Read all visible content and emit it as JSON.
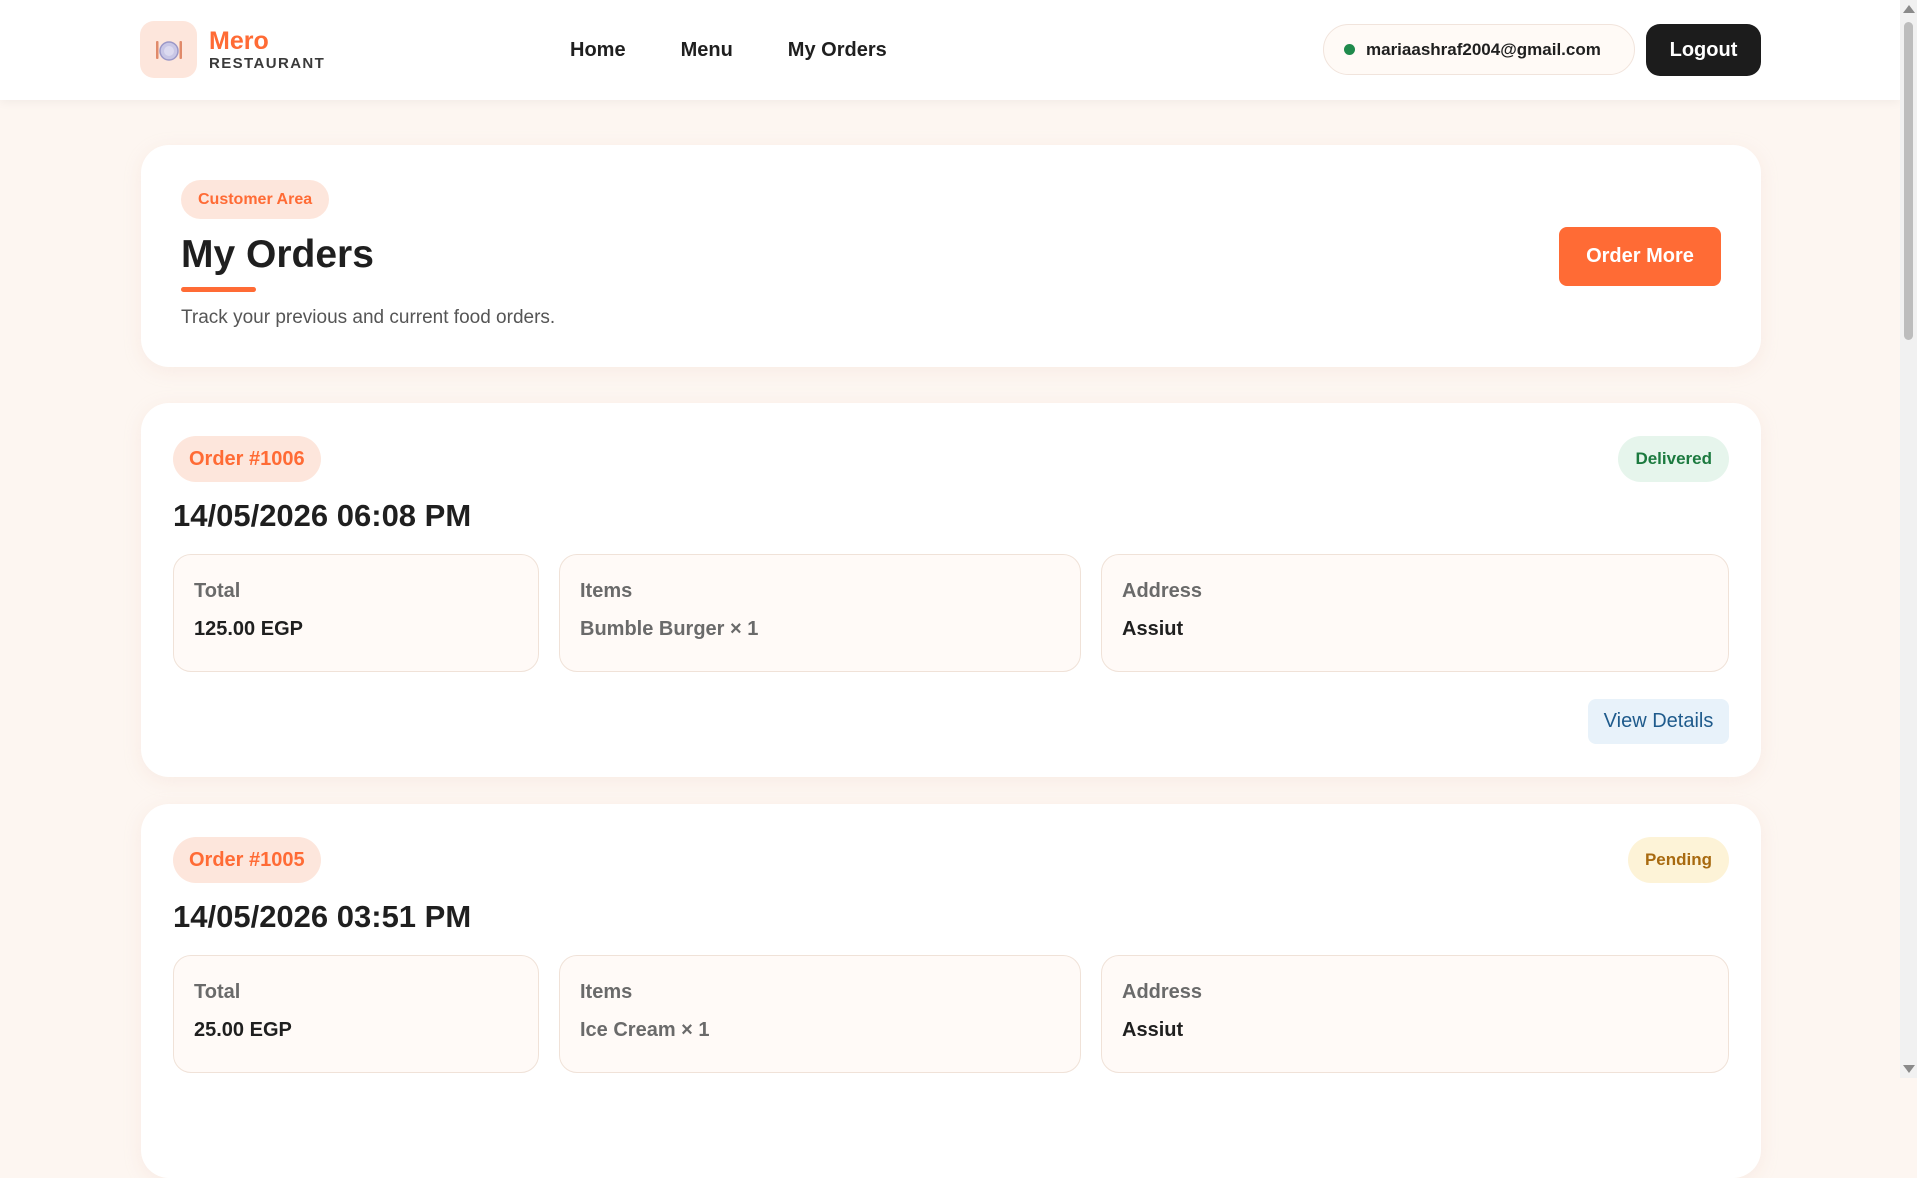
{
  "navbar": {
    "brand": {
      "name": "Mero",
      "subtitle": "RESTAURANT",
      "logo_icon": "plate-cutlery-icon"
    },
    "links": [
      {
        "label": "Home"
      },
      {
        "label": "Menu"
      },
      {
        "label": "My Orders"
      }
    ],
    "user_email": "mariaashraf2004@gmail.com",
    "logout_label": "Logout"
  },
  "header": {
    "badge": "Customer Area",
    "title": "My Orders",
    "subtitle": "Track your previous and current food orders.",
    "order_more_label": "Order More"
  },
  "orders": [
    {
      "id_label": "Order #1006",
      "date": "14/05/2026 06:08 PM",
      "status": "Delivered",
      "total_label": "Total",
      "total": "125.00 EGP",
      "items_label": "Items",
      "items": "Bumble Burger × 1",
      "address_label": "Address",
      "address": "Assiut",
      "details_label": "View Details"
    },
    {
      "id_label": "Order #1005",
      "date": "14/05/2026 03:51 PM",
      "status": "Pending",
      "total_label": "Total",
      "total": "25.00 EGP",
      "items_label": "Items",
      "items": "Ice Cream × 1",
      "address_label": "Address",
      "address": "Assiut"
    }
  ],
  "colors": {
    "accent": "#ff6b35",
    "background": "#fdf6f1",
    "delivered": "#1c7a3f",
    "pending": "#a86a10"
  }
}
